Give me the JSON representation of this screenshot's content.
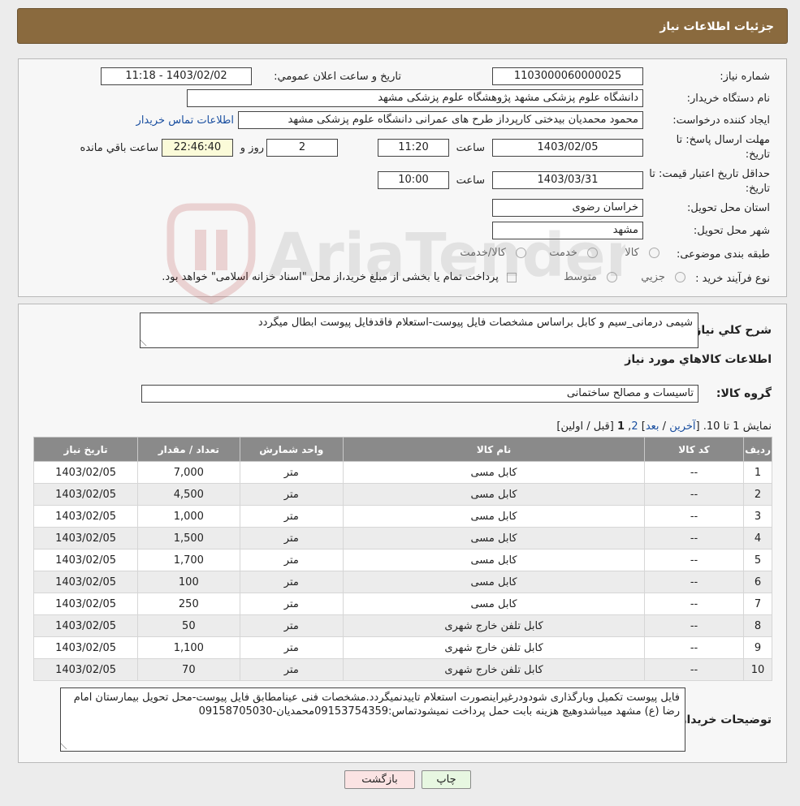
{
  "header": {
    "title": "جزئیات اطلاعات نیاز"
  },
  "form": {
    "need_number_label": "شماره نیاز:",
    "need_number": "1103000060000025",
    "announce_label": "تاریخ و ساعت اعلان عمومي:",
    "announce_value": "1403/02/02 - 11:18",
    "buyer_org_label": "نام دستگاه خریدار:",
    "buyer_org": "دانشگاه علوم پزشکی مشهد   پژوهشگاه علوم پزشکی مشهد",
    "requester_label": "ایجاد کننده درخواست:",
    "requester": "محمود محمدیان بیدختی کارپرداز طرح های عمرانی دانشگاه علوم پزشکی مشهد",
    "contact_link": "اطلاعات تماس خریدار",
    "deadline_label_1": "مهلت ارسال پاسخ: تا",
    "deadline_label_2": "تاریخ:",
    "deadline_date": "1403/02/05",
    "time_label": "ساعت",
    "deadline_time": "11:20",
    "days_value": "2",
    "days_label": "روز و",
    "remaining_time": "22:46:40",
    "remaining_label": "ساعت باقي مانده",
    "validity_label_1": "حداقل تاریخ اعتبار قیمت: تا",
    "validity_label_2": "تاریخ:",
    "validity_date": "1403/03/31",
    "validity_time": "10:00",
    "province_label": "استان محل تحویل:",
    "province": "خراسان رضوی",
    "city_label": "شهر محل تحویل:",
    "city": "مشهد",
    "category_label": "طبقه بندی موضوعی:",
    "category_options": [
      "کالا",
      "خدمت",
      "کالا/خدمت"
    ],
    "process_label": "نوع فرآیند خرید :",
    "process_options": [
      "جزیي",
      "متوسط"
    ],
    "process_note": "پرداخت تمام یا بخشی از مبلغ خرید،از محل \"اسناد خزانه اسلامی\" خواهد بود."
  },
  "details": {
    "summary_label": "شرح کلي نياز:",
    "summary": "شیمی درمانی_سیم و کابل براساس مشخصات فایل پیوست-استعلام فاقدفایل پیوست ابطال میگردد",
    "goods_info_title": "اطلاعات کالاهاي مورد نياز",
    "goods_group_label": "گروه کالا:",
    "goods_group": "تاسیسات و مصالح ساختمانی",
    "pager_show": "نمایش 1 تا 10.",
    "pager_open": "[",
    "pager_last": "آخرین",
    "pager_sep1": "/",
    "pager_next": "بعد",
    "pager_close": "]",
    "pager_page2": "2",
    "pager_comma": ",",
    "pager_page1": "1",
    "pager_tail": "[قبل / اولین]",
    "buyer_notes_label": "توضیحات خریدار:",
    "buyer_notes": "فایل پیوست تکمیل وبارگذاری شودودرغیراینصورت استعلام تاییدنمیگردد.مشخصات فنی عینامطابق فایل پیوست-محل تحویل بیمارستان امام رضا (ع) مشهد میباشدوهیچ هزینه بابت حمل پرداخت نمیشودتماس:09153754359محمدیان-09158705030"
  },
  "table": {
    "headers": [
      "ردیف",
      "کد کالا",
      "نام کالا",
      "واحد شمارش",
      "تعداد / مقدار",
      "تاریخ نیاز"
    ],
    "rows": [
      [
        "1",
        "--",
        "کابل مسی",
        "متر",
        "7,000",
        "1403/02/05"
      ],
      [
        "2",
        "--",
        "کابل مسی",
        "متر",
        "4,500",
        "1403/02/05"
      ],
      [
        "3",
        "--",
        "کابل مسی",
        "متر",
        "1,000",
        "1403/02/05"
      ],
      [
        "4",
        "--",
        "کابل مسی",
        "متر",
        "1,500",
        "1403/02/05"
      ],
      [
        "5",
        "--",
        "کابل مسی",
        "متر",
        "1,700",
        "1403/02/05"
      ],
      [
        "6",
        "--",
        "کابل مسی",
        "متر",
        "100",
        "1403/02/05"
      ],
      [
        "7",
        "--",
        "کابل مسی",
        "متر",
        "250",
        "1403/02/05"
      ],
      [
        "8",
        "--",
        "کابل تلفن خارج شهری",
        "متر",
        "50",
        "1403/02/05"
      ],
      [
        "9",
        "--",
        "کابل تلفن خارج شهری",
        "متر",
        "1,100",
        "1403/02/05"
      ],
      [
        "10",
        "--",
        "کابل تلفن خارج شهری",
        "متر",
        "70",
        "1403/02/05"
      ]
    ]
  },
  "buttons": {
    "print": "چاپ",
    "back": "بازگشت"
  },
  "watermark": {
    "text": "AriaTender.neT"
  },
  "colors": {
    "header_bg": "#8a6a3e",
    "table_header_bg": "#8a8a8a",
    "link": "#1a4fa0",
    "back_button_bg": "#fbe3e3",
    "print_button_bg": "#e7f7e1"
  }
}
